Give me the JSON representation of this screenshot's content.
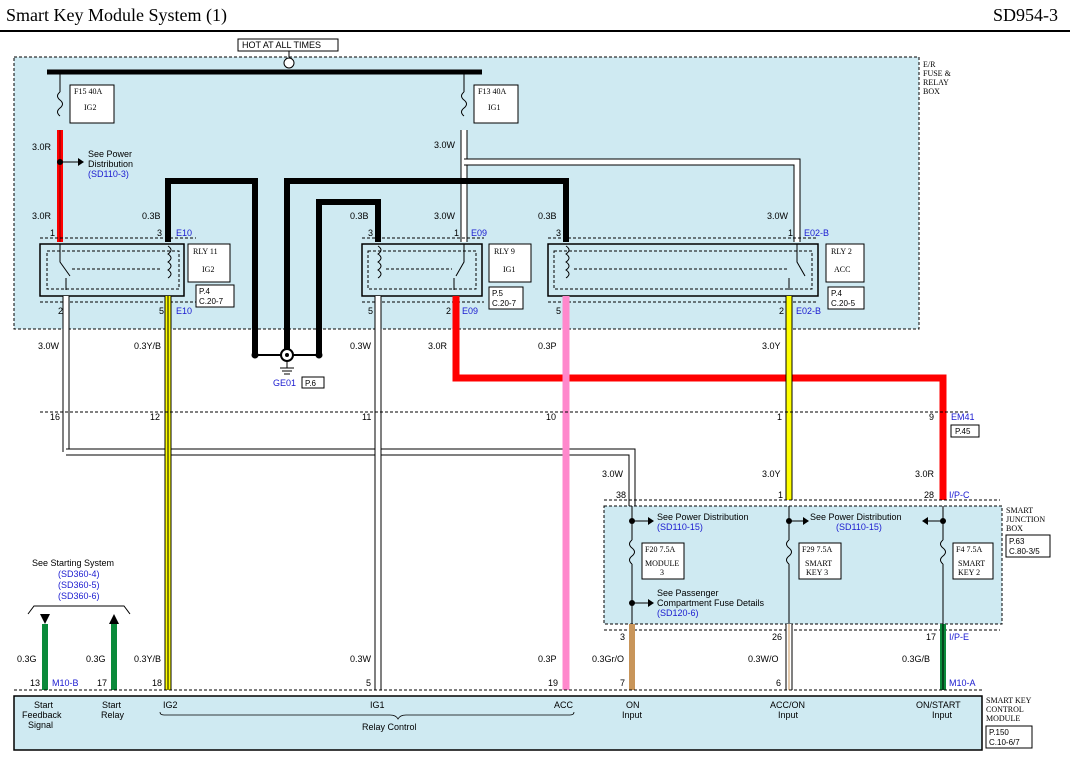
{
  "header": {
    "title": "Smart Key Module System (1)",
    "code": "SD954-3"
  },
  "hot_at_all_times": "HOT AT ALL TIMES",
  "er_box": {
    "line1": "E/R",
    "line2": "FUSE &",
    "line3": "RELAY",
    "line4": "BOX"
  },
  "fuses": {
    "f15": {
      "name": "F15 40A",
      "label": "IG2"
    },
    "f13": {
      "name": "F13 40A",
      "label": "IG1"
    },
    "f20": {
      "name": "F20 7.5A",
      "line1": "MODULE",
      "line2": "3"
    },
    "f29": {
      "name": "F29 7.5A",
      "line1": "SMART",
      "line2": "KEY 3"
    },
    "f4": {
      "name": "F4 7.5A",
      "line1": "SMART",
      "line2": "KEY 2"
    }
  },
  "relays": {
    "rly11": {
      "name": "RLY 11",
      "label": "IG2",
      "ref1": "P.4",
      "ref2": "C.20-7"
    },
    "rly9": {
      "name": "RLY 9",
      "label": "IG1",
      "ref1": "P.5",
      "ref2": "C.20-7"
    },
    "rly2": {
      "name": "RLY 2",
      "label": "ACC",
      "ref1": "P.4",
      "ref2": "C.20-5"
    }
  },
  "see_power": {
    "line1": "See Power",
    "line2": "Distribution",
    "ref": "(SD110-3)"
  },
  "wires": {
    "w_30r": "3.0R",
    "w_30w": "3.0W",
    "w_03b": "0.3B",
    "w_03yb": "0.3Y/B",
    "w_03w": "0.3W",
    "w_03p": "0.3P",
    "w_30y": "3.0Y",
    "w_03g": "0.3G",
    "w_03gro": "0.3Gr/O",
    "w_03wo": "0.3W/O",
    "w_03gb": "0.3G/B"
  },
  "pins": {
    "p1": "1",
    "p2": "2",
    "p3": "3",
    "p5": "5",
    "p6": "6",
    "p7": "7",
    "p9": "9",
    "p10": "10",
    "p11": "11",
    "p12": "12",
    "p13": "13",
    "p16": "16",
    "p17": "17",
    "p18": "18",
    "p19": "19",
    "p26": "26",
    "p28": "28",
    "p38": "38"
  },
  "connectors": {
    "e10": "E10",
    "e09": "E09",
    "e02b": "E02-B",
    "em41": "EM41",
    "em41_ref": "P.45",
    "ipc": "I/P-C",
    "ipe": "I/P-E",
    "m10a": "M10-A",
    "m10b": "M10-B"
  },
  "ground": {
    "name": "GE01",
    "ref": "P.6"
  },
  "junction_box": {
    "line1": "SMART",
    "line2": "JUNCTION",
    "line3": "BOX",
    "ref1": "P.63",
    "ref2": "C.80-3/5",
    "see_power_dist": "See Power Distribution",
    "ref_sd110_15": "(SD110-15)",
    "see_passenger": "See Passenger",
    "compartment": "Compartment Fuse Details",
    "ref_sd120_6": "(SD120-6)"
  },
  "starting": {
    "title": "See Starting System",
    "r1": "(SD360-4)",
    "r2": "(SD360-5)",
    "r3": "(SD360-6)"
  },
  "module": {
    "line1": "SMART KEY",
    "line2": "CONTROL",
    "line3": "MODULE",
    "ref1": "P.150",
    "ref2": "C.10-6/7",
    "start_feedback_1": "Start",
    "start_feedback_2": "Feedback",
    "start_feedback_3": "Signal",
    "start_relay_1": "Start",
    "start_relay_2": "Relay",
    "ig2": "IG2",
    "ig1": "IG1",
    "acc": "ACC",
    "relay_control": "Relay Control",
    "on_1": "ON",
    "on_2": "Input",
    "accon_1": "ACC/ON",
    "accon_2": "Input",
    "onstart_1": "ON/START",
    "onstart_2": "Input"
  },
  "colors": {
    "box_fill": "#cfeaf2",
    "red": "#ff0000",
    "yellow": "#ffff00",
    "pink": "#ff88cc",
    "green": "#0a8a3a",
    "tan": "#c8955a",
    "black": "#000000"
  }
}
